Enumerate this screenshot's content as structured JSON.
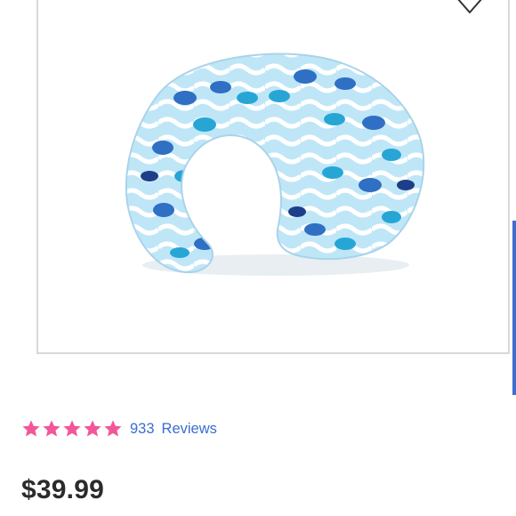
{
  "product": {
    "image_alt": "Nursing pillow with blue whale pattern",
    "wishlist_icon": "heart-outline-icon",
    "rating": {
      "stars": 5,
      "max": 5,
      "count": "933",
      "label": "Reviews"
    },
    "price": "$39.99"
  },
  "colors": {
    "star": "#f2579a",
    "link": "#3a6ed0",
    "price": "#2b2b2b",
    "border": "#d9d9d9"
  }
}
